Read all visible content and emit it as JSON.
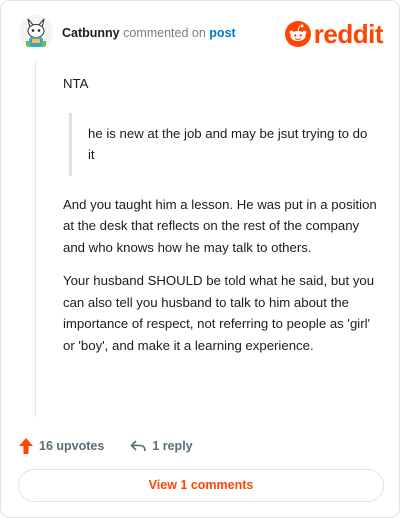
{
  "comment": {
    "username": "Catbunny",
    "verb": "commented on",
    "target": "post",
    "paragraphs": {
      "p1": "NTA",
      "quote": "he is new at the job and may be jsut trying to do it",
      "p2": "And you taught him a lesson. He was put in a position at the desk that reflects on the rest of the company and who knows how he may talk to others.",
      "p3": "Your husband SHOULD be told what he said, but you can also tell you husband to talk to him about the importance of respect, not referring to people as 'girl' or 'boy', and make it a learning experience."
    }
  },
  "brand": {
    "wordmark": "reddit",
    "accent": "#ff4500"
  },
  "actions": {
    "upvotes": "16 upvotes",
    "replies": "1 reply"
  },
  "footer": {
    "view_comments": "View 1 comments"
  },
  "icons": [
    "avatar",
    "reddit-logo-icon",
    "upvote-arrow-icon",
    "reply-arrow-icon"
  ]
}
